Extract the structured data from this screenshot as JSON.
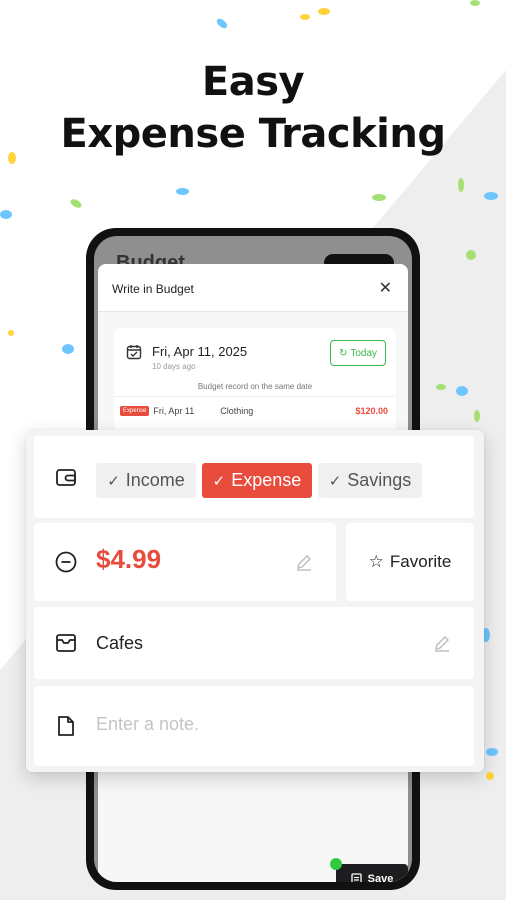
{
  "headline": {
    "line1": "Easy",
    "line2": "Expense Tracking"
  },
  "colors": {
    "accent_red": "#e84c3d",
    "accent_green": "#39b54a",
    "dark": "#1d1d1f"
  },
  "phone": {
    "screen_title": "Budget",
    "sheet": {
      "title": "Write in Budget",
      "close_icon": "close-icon",
      "date": {
        "main": "Fri, Apr 11, 2025",
        "sub": "10 days ago",
        "today_label": "Today"
      },
      "same_date_label": "Budget record on the same date",
      "record": {
        "badge": "Expense",
        "date": "Fri, Apr 11",
        "category": "Clothing",
        "amount": "$120.00"
      }
    },
    "save_label": "Save"
  },
  "form": {
    "type_options": [
      {
        "label": "Income",
        "selected": false
      },
      {
        "label": "Expense",
        "selected": true
      },
      {
        "label": "Savings",
        "selected": false
      }
    ],
    "amount": "$4.99",
    "favorite_label": "Favorite",
    "category": "Cafes",
    "note_placeholder": "Enter a note."
  }
}
